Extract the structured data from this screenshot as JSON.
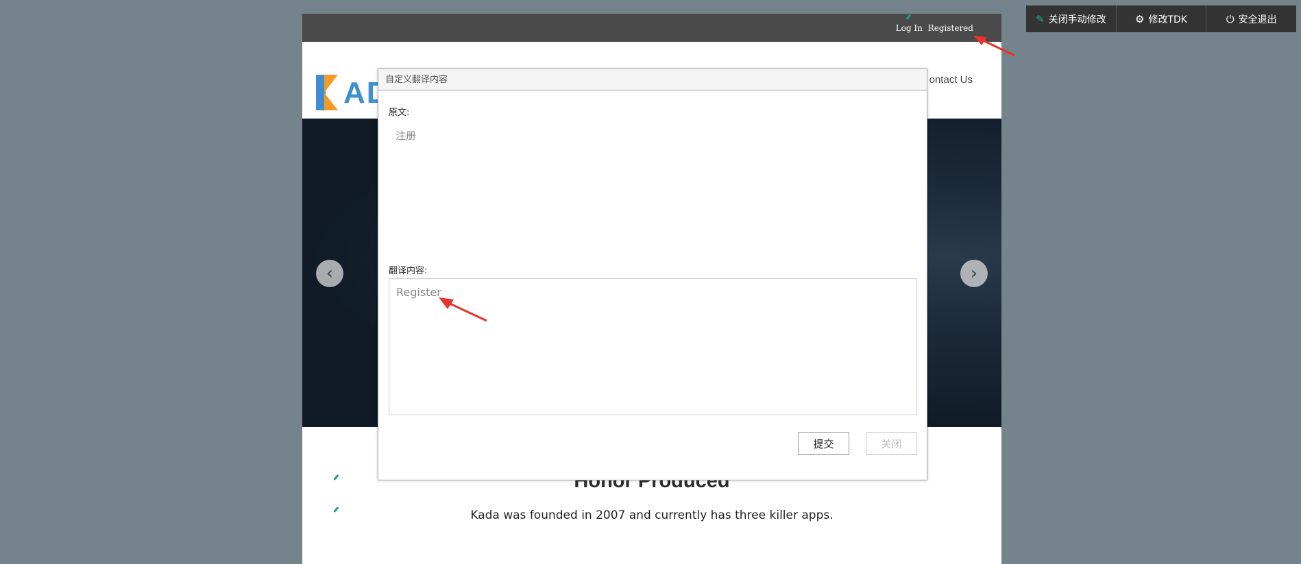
{
  "site": {
    "topbar": {
      "login": "Log In",
      "register": "Registered"
    },
    "nav": {
      "contact": "ontact Us"
    },
    "logo": {
      "text": "AD"
    },
    "banner": {
      "prev_glyph": "‹",
      "next_glyph": "›"
    },
    "section": {
      "title": "Honor  Produced",
      "text": "Kada was founded in 2007 and currently has three killer apps."
    }
  },
  "admin_bar": {
    "items": [
      {
        "label": "关闭手动修改",
        "icon": "pencil-icon",
        "glyph": "✎"
      },
      {
        "label": "修改TDK",
        "icon": "gear-icon",
        "glyph": "⚙"
      },
      {
        "label": "安全退出",
        "icon": "power-icon",
        "glyph": "⏻"
      }
    ]
  },
  "dialog": {
    "title": "自定义翻译内容",
    "original_label": "原文:",
    "original_value": "注册",
    "translation_label": "翻译内容:",
    "translation_value": "Register",
    "submit_label": "提交",
    "close_label": "关闭"
  },
  "colors": {
    "backdrop": "#74838c",
    "topbar": "#4a4a4a",
    "admin_bar": "#333333",
    "accent_teal": "#1fb39c",
    "logo_blue": "#3e8ed0",
    "logo_orange": "#f39a27",
    "annotation_red": "#e8322b"
  }
}
